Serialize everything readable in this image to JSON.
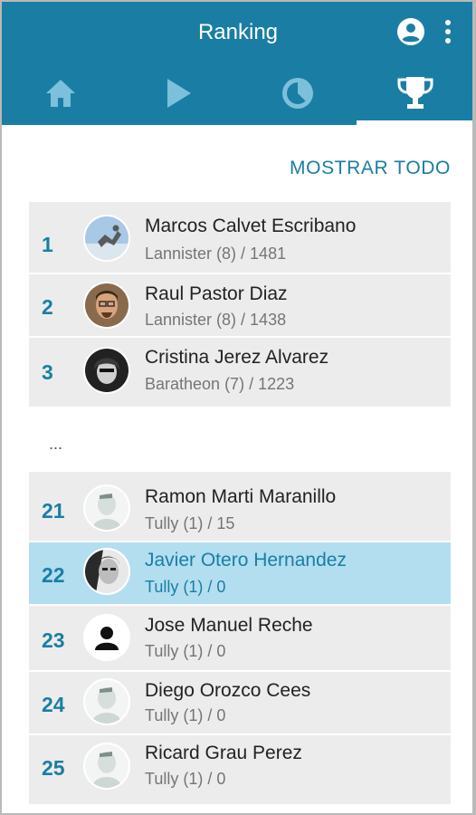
{
  "header": {
    "title": "Ranking"
  },
  "icons": {
    "account": "account-circle-icon",
    "more": "more-vertical-icon",
    "tabs": [
      "home-icon",
      "play-icon",
      "timer-icon",
      "trophy-icon"
    ]
  },
  "colors": {
    "primary": "#1a7ea4",
    "highlight": "#b3def0",
    "row": "#ececec"
  },
  "show_all": "MOSTRAR TODO",
  "top": [
    {
      "rank": "1",
      "name": "Marcos Calvet Escribano",
      "detail": "Lannister (8) / 1481"
    },
    {
      "rank": "2",
      "name": "Raul Pastor Diaz",
      "detail": "Lannister (8) / 1438"
    },
    {
      "rank": "3",
      "name": "Cristina Jerez Alvarez",
      "detail": "Baratheon (7) / 1223"
    }
  ],
  "ellipsis": "...",
  "bottom": [
    {
      "rank": "21",
      "name": "Ramon Marti Maranillo",
      "detail": "Tully (1) / 15"
    },
    {
      "rank": "22",
      "name": "Javier Otero Hernandez",
      "detail": "Tully (1) / 0"
    },
    {
      "rank": "23",
      "name": "Jose Manuel Reche",
      "detail": "Tully (1) / 0"
    },
    {
      "rank": "24",
      "name": "Diego Orozco Cees",
      "detail": "Tully (1) / 0"
    },
    {
      "rank": "25",
      "name": "Ricard Grau Perez",
      "detail": "Tully (1) / 0"
    }
  ]
}
